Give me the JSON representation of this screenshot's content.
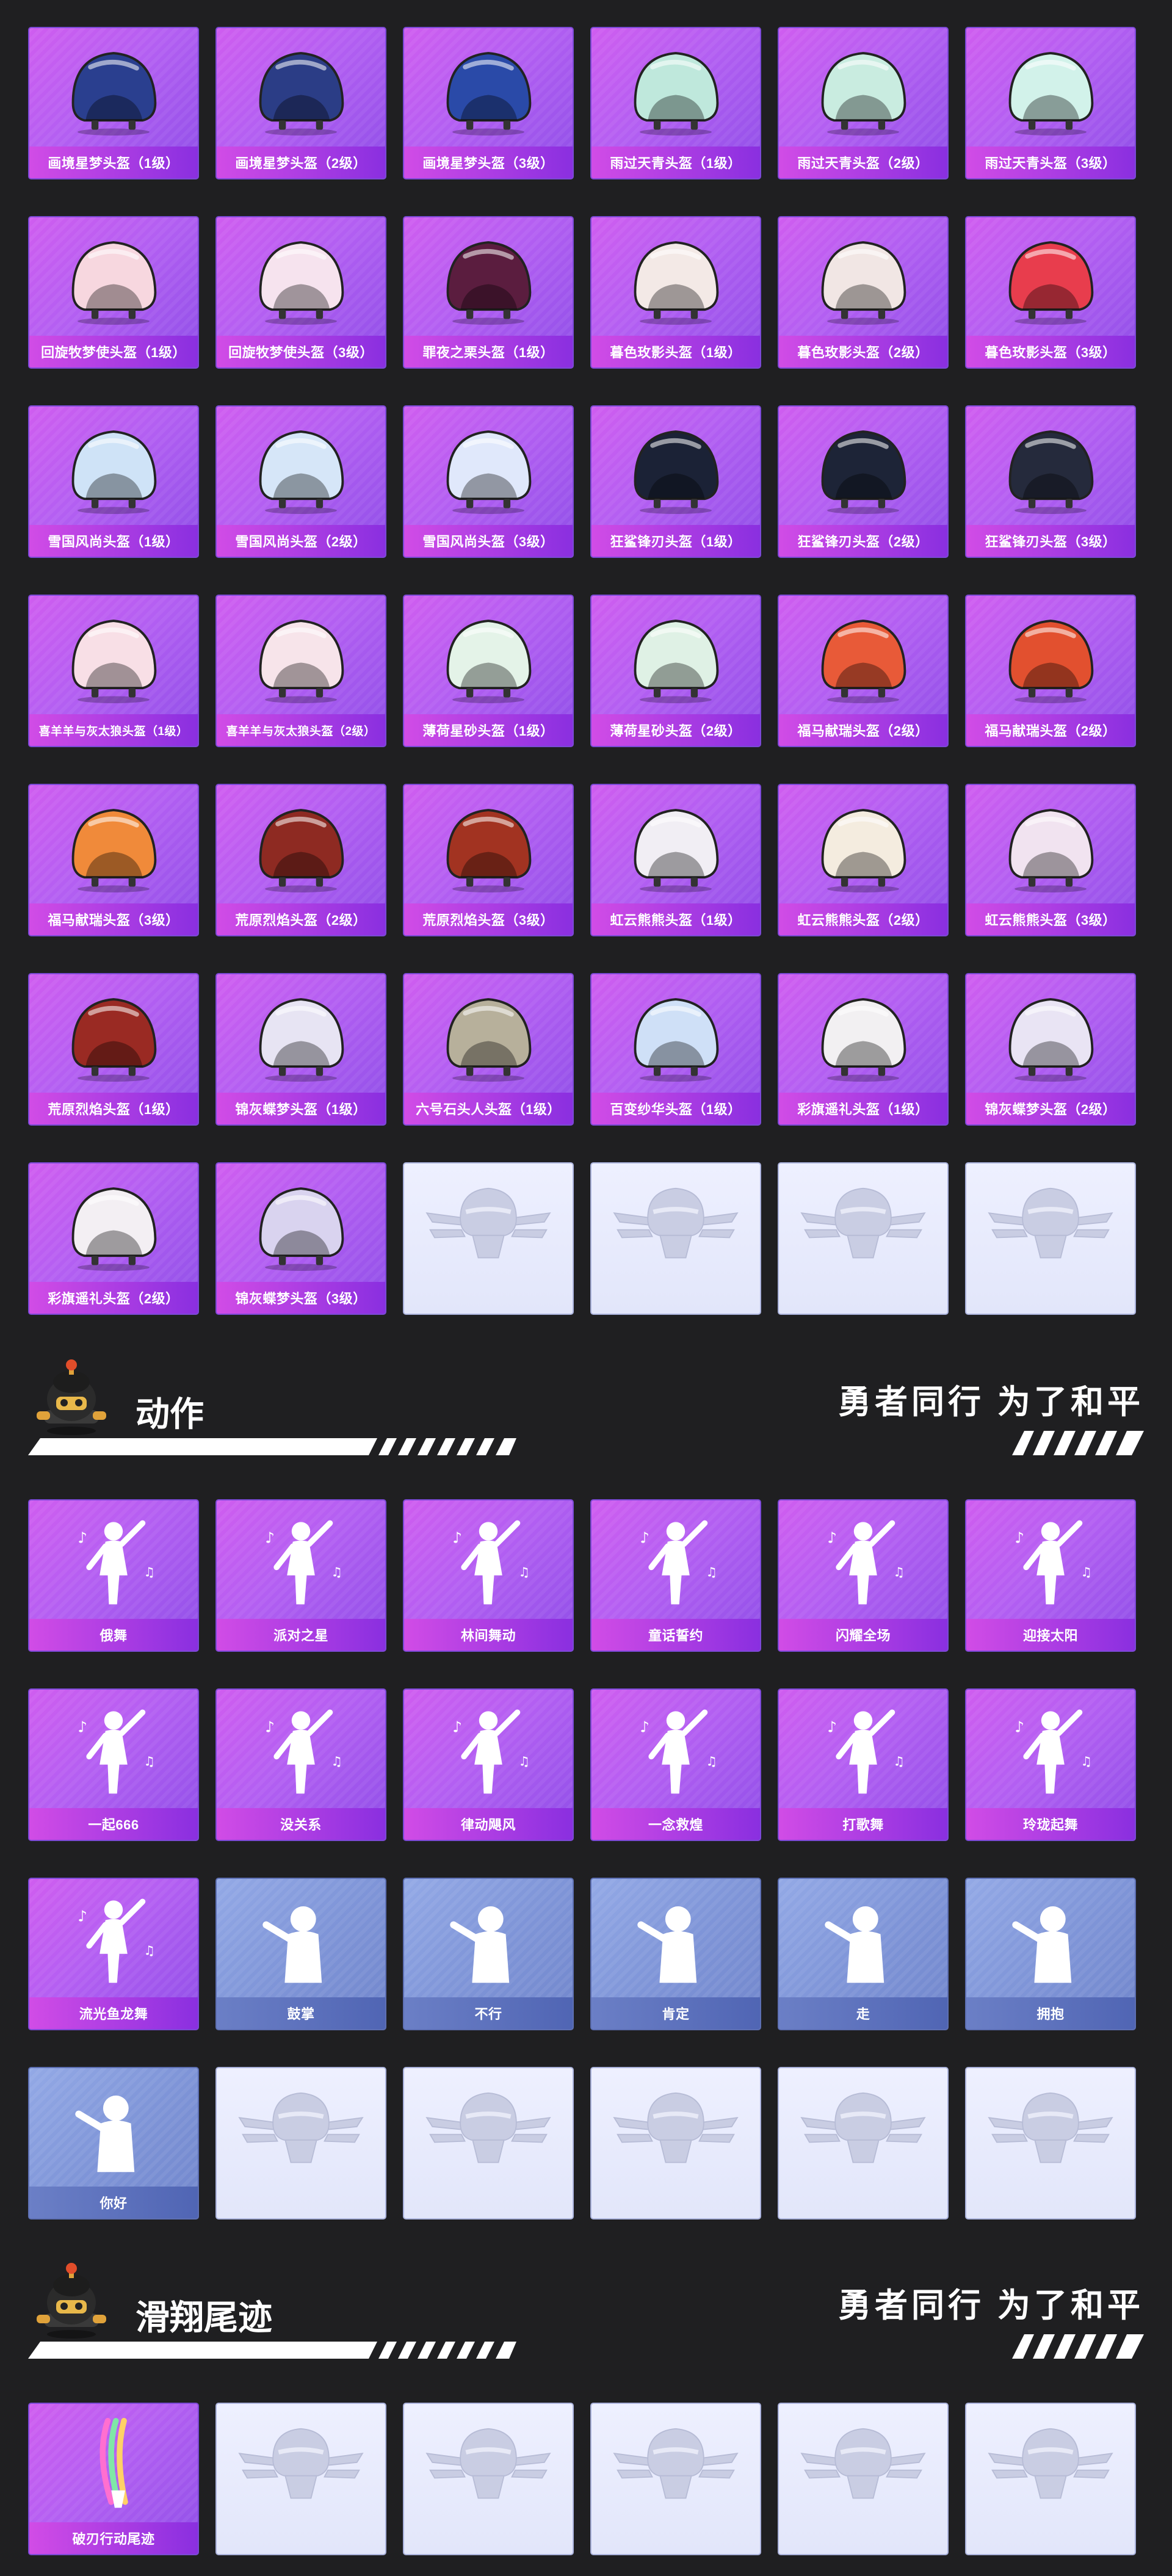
{
  "helmets": {
    "items": [
      {
        "label": "画境星梦头盔（1级）",
        "tier": "rare",
        "icon": "helmet-icon",
        "color": "#2a3f8f"
      },
      {
        "label": "画境星梦头盔（2级）",
        "tier": "rare",
        "icon": "helmet-icon",
        "color": "#2b3d86"
      },
      {
        "label": "画境星梦头盔（3级）",
        "tier": "rare",
        "icon": "helmet-icon",
        "color": "#2a4aa8"
      },
      {
        "label": "雨过天青头盔（1级）",
        "tier": "rare",
        "icon": "helmet-icon",
        "color": "#bfe8dc"
      },
      {
        "label": "雨过天青头盔（2级）",
        "tier": "rare",
        "icon": "helmet-icon",
        "color": "#c9ece0"
      },
      {
        "label": "雨过天青头盔（3级）",
        "tier": "rare",
        "icon": "helmet-icon",
        "color": "#d2f2ea"
      },
      {
        "label": "回旋牧梦使头盔（1级）",
        "tier": "rare",
        "icon": "helmet-icon",
        "color": "#f7d7df"
      },
      {
        "label": "回旋牧梦使头盔（3级）",
        "tier": "rare",
        "icon": "helmet-icon",
        "color": "#f6e3ee"
      },
      {
        "label": "罪夜之栗头盔（1级）",
        "tier": "rare",
        "icon": "helmet-icon",
        "color": "#5b1d3f"
      },
      {
        "label": "暮色玫影头盔（1级）",
        "tier": "rare",
        "icon": "helmet-icon",
        "color": "#f3e9e6"
      },
      {
        "label": "暮色玫影头盔（2级）",
        "tier": "rare",
        "icon": "helmet-icon",
        "color": "#f1e6e4"
      },
      {
        "label": "暮色玫影头盔（3级）",
        "tier": "rare",
        "icon": "helmet-icon",
        "color": "#e83d4d"
      },
      {
        "label": "雪国风尚头盔（1级）",
        "tier": "rare",
        "icon": "helmet-icon",
        "color": "#cfe3f7"
      },
      {
        "label": "雪国风尚头盔（2级）",
        "tier": "rare",
        "icon": "helmet-icon",
        "color": "#d6e6f8"
      },
      {
        "label": "雪国风尚头盔（3级）",
        "tier": "rare",
        "icon": "helmet-icon",
        "color": "#e0e8fb"
      },
      {
        "label": "狂鲨锋刃头盔（1级）",
        "tier": "rare",
        "icon": "helmet-icon",
        "color": "#1b2236"
      },
      {
        "label": "狂鲨锋刃头盔（2级）",
        "tier": "rare",
        "icon": "helmet-icon",
        "color": "#1d2437"
      },
      {
        "label": "狂鲨锋刃头盔（3级）",
        "tier": "rare",
        "icon": "helmet-icon",
        "color": "#252a3c"
      },
      {
        "label": "喜羊羊与灰太狼头盔（1级）",
        "tier": "rare",
        "icon": "helmet-icon",
        "color": "#f8dfe6",
        "small": true
      },
      {
        "label": "喜羊羊与灰太狼头盔（2级）",
        "tier": "rare",
        "icon": "helmet-icon",
        "color": "#f7e4ea",
        "small": true
      },
      {
        "label": "薄荷星砂头盔（1级）",
        "tier": "rare",
        "icon": "helmet-icon",
        "color": "#e4f3e8"
      },
      {
        "label": "薄荷星砂头盔（2级）",
        "tier": "rare",
        "icon": "helmet-icon",
        "color": "#dff1e5"
      },
      {
        "label": "福马献瑞头盔（2级）",
        "tier": "rare",
        "icon": "helmet-icon",
        "color": "#e85a38"
      },
      {
        "label": "福马献瑞头盔（2级）",
        "tier": "rare",
        "icon": "helmet-icon",
        "color": "#e2502f"
      },
      {
        "label": "福马献瑞头盔（3级）",
        "tier": "rare",
        "icon": "helmet-icon",
        "color": "#f08a3a"
      },
      {
        "label": "荒原烈焰头盔（2级）",
        "tier": "rare",
        "icon": "helmet-icon",
        "color": "#8e2a22"
      },
      {
        "label": "荒原烈焰头盔（3级）",
        "tier": "rare",
        "icon": "helmet-icon",
        "color": "#a23321"
      },
      {
        "label": "虹云熊熊头盔（1级）",
        "tier": "rare",
        "icon": "helmet-icon",
        "color": "#f1eef4"
      },
      {
        "label": "虹云熊熊头盔（2级）",
        "tier": "rare",
        "icon": "helmet-icon",
        "color": "#f4ecdf"
      },
      {
        "label": "虹云熊熊头盔（3级）",
        "tier": "rare",
        "icon": "helmet-icon",
        "color": "#f1e3f0"
      },
      {
        "label": "荒原烈焰头盔（1级）",
        "tier": "rare",
        "icon": "helmet-icon",
        "color": "#9a2a23"
      },
      {
        "label": "锦灰蝶梦头盔（1级）",
        "tier": "rare",
        "icon": "helmet-icon",
        "color": "#e7e4f3"
      },
      {
        "label": "六号石头人头盔（1级）",
        "tier": "rare",
        "icon": "helmet-icon",
        "color": "#b7b09b"
      },
      {
        "label": "百变纱华头盔（1级）",
        "tier": "rare",
        "icon": "helmet-icon",
        "color": "#cfe0f7"
      },
      {
        "label": "彩旗遥礼头盔（1级）",
        "tier": "rare",
        "icon": "helmet-icon",
        "color": "#f2f0f2"
      },
      {
        "label": "锦灰蝶梦头盔（2级）",
        "tier": "rare",
        "icon": "helmet-icon",
        "color": "#e9e4f4"
      },
      {
        "label": "彩旗遥礼头盔（2级）",
        "tier": "rare",
        "icon": "helmet-icon",
        "color": "#f3eff3"
      },
      {
        "label": "锦灰蝶梦头盔（3级）",
        "tier": "rare",
        "icon": "helmet-icon",
        "color": "#d9d3ef"
      },
      {
        "label": "",
        "tier": "empty",
        "icon": "emblem-placeholder-icon"
      },
      {
        "label": "",
        "tier": "empty",
        "icon": "emblem-placeholder-icon"
      },
      {
        "label": "",
        "tier": "empty",
        "icon": "emblem-placeholder-icon"
      },
      {
        "label": "",
        "tier": "empty",
        "icon": "emblem-placeholder-icon"
      }
    ]
  },
  "emotes": {
    "title": "动作",
    "slogan": "勇者同行 为了和平",
    "items": [
      {
        "label": "俄舞",
        "tier": "rare",
        "icon": "dance-icon"
      },
      {
        "label": "派对之星",
        "tier": "rare",
        "icon": "dance-icon"
      },
      {
        "label": "林间舞动",
        "tier": "rare",
        "icon": "dance-icon"
      },
      {
        "label": "童话誓约",
        "tier": "rare",
        "icon": "dance-icon"
      },
      {
        "label": "闪耀全场",
        "tier": "rare",
        "icon": "dance-icon"
      },
      {
        "label": "迎接太阳",
        "tier": "rare",
        "icon": "dance-icon"
      },
      {
        "label": "一起666",
        "tier": "rare",
        "icon": "dance-icon"
      },
      {
        "label": "没关系",
        "tier": "rare",
        "icon": "dance-icon"
      },
      {
        "label": "律动飓风",
        "tier": "rare",
        "icon": "dance-icon"
      },
      {
        "label": "一念救煌",
        "tier": "rare",
        "icon": "dance-icon"
      },
      {
        "label": "打歌舞",
        "tier": "rare",
        "icon": "dance-icon"
      },
      {
        "label": "玲珑起舞",
        "tier": "rare",
        "icon": "dance-icon"
      },
      {
        "label": "流光鱼龙舞",
        "tier": "rare",
        "icon": "dance-icon"
      },
      {
        "label": "鼓掌",
        "tier": "common",
        "icon": "clap-icon"
      },
      {
        "label": "不行",
        "tier": "common",
        "icon": "head-shake-icon"
      },
      {
        "label": "肯定",
        "tier": "common",
        "icon": "nod-icon"
      },
      {
        "label": "走",
        "tier": "common",
        "icon": "point-icon"
      },
      {
        "label": "拥抱",
        "tier": "common",
        "icon": "hug-icon"
      },
      {
        "label": "你好",
        "tier": "common",
        "icon": "wave-icon"
      },
      {
        "label": "",
        "tier": "empty",
        "icon": "emblem-placeholder-icon"
      },
      {
        "label": "",
        "tier": "empty",
        "icon": "emblem-placeholder-icon"
      },
      {
        "label": "",
        "tier": "empty",
        "icon": "emblem-placeholder-icon"
      },
      {
        "label": "",
        "tier": "empty",
        "icon": "emblem-placeholder-icon"
      },
      {
        "label": "",
        "tier": "empty",
        "icon": "emblem-placeholder-icon"
      }
    ]
  },
  "trails": {
    "title": "滑翔尾迹",
    "slogan": "勇者同行 为了和平",
    "items": [
      {
        "label": "破刃行动尾迹",
        "tier": "rare",
        "icon": "glide-trail-icon"
      },
      {
        "label": "",
        "tier": "empty",
        "icon": "emblem-placeholder-icon"
      },
      {
        "label": "",
        "tier": "empty",
        "icon": "emblem-placeholder-icon"
      },
      {
        "label": "",
        "tier": "empty",
        "icon": "emblem-placeholder-icon"
      },
      {
        "label": "",
        "tier": "empty",
        "icon": "emblem-placeholder-icon"
      },
      {
        "label": "",
        "tier": "empty",
        "icon": "emblem-placeholder-icon"
      }
    ]
  },
  "colors": {
    "background": "#1f1f21",
    "rare_top": "#cf5df0",
    "rare_bottom": "#8f4fe8",
    "common": "#7f95d8",
    "empty": "#e6e9fb",
    "label_bar": "#8a2fe0"
  }
}
